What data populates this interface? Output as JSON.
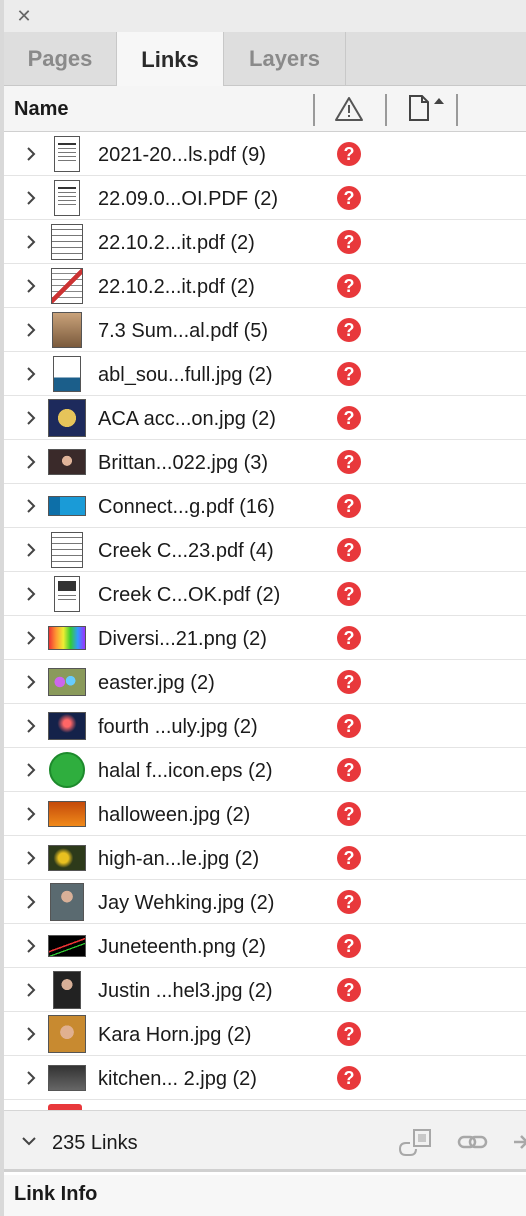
{
  "panel": {
    "close_glyph": "✕"
  },
  "tabs": [
    {
      "label": "Pages",
      "active": false
    },
    {
      "label": "Links",
      "active": true
    },
    {
      "label": "Layers",
      "active": false
    }
  ],
  "columns": {
    "name": "Name",
    "status_icon": "warning-triangle-icon",
    "page_icon": "page-sort-icon"
  },
  "links": [
    {
      "name": "2021-20...ls.pdf (9)",
      "thumb": "doc",
      "status": "missing"
    },
    {
      "name": "22.09.0...OI.PDF (2)",
      "thumb": "doc",
      "status": "missing"
    },
    {
      "name": "22.10.2...it.pdf (2)",
      "thumb": "table",
      "status": "missing"
    },
    {
      "name": "22.10.2...it.pdf (2)",
      "thumb": "table-red",
      "status": "missing"
    },
    {
      "name": "7.3 Sum...al.pdf (5)",
      "thumb": "photo-people",
      "status": "missing"
    },
    {
      "name": "abl_sou...full.jpg (2)",
      "thumb": "abl",
      "status": "missing"
    },
    {
      "name": "ACA acc...on.jpg (2)",
      "thumb": "badge",
      "status": "missing"
    },
    {
      "name": "Brittan...022.jpg (3)",
      "thumb": "portrait",
      "status": "missing"
    },
    {
      "name": "Connect...g.pdf (16)",
      "thumb": "blue-banner",
      "status": "missing"
    },
    {
      "name": "Creek C...23.pdf (4)",
      "thumb": "table",
      "status": "missing"
    },
    {
      "name": "Creek C...OK.pdf (2)",
      "thumb": "doc-dark",
      "status": "missing"
    },
    {
      "name": "Diversi...21.png (2)",
      "thumb": "diversity",
      "status": "missing"
    },
    {
      "name": "easter.jpg (2)",
      "thumb": "eggs",
      "status": "missing"
    },
    {
      "name": "fourth ...uly.jpg (2)",
      "thumb": "fireworks",
      "status": "missing"
    },
    {
      "name": "halal f...icon.eps (2)",
      "thumb": "halal",
      "status": "missing"
    },
    {
      "name": "halloween.jpg (2)",
      "thumb": "halloween",
      "status": "missing"
    },
    {
      "name": "high-an...le.jpg (2)",
      "thumb": "flowers",
      "status": "missing"
    },
    {
      "name": "Jay Wehking.jpg (2)",
      "thumb": "man-suit",
      "status": "missing"
    },
    {
      "name": "Juneteenth.png (2)",
      "thumb": "juneteenth",
      "status": "missing"
    },
    {
      "name": "Justin ...hel3.jpg (2)",
      "thumb": "man-dark",
      "status": "missing"
    },
    {
      "name": "Kara Horn.jpg (2)",
      "thumb": "woman",
      "status": "missing"
    },
    {
      "name": "kitchen... 2.jpg (2)",
      "thumb": "kitchen",
      "status": "missing"
    }
  ],
  "missing_glyph": "?",
  "footer": {
    "count_label": "235 Links",
    "icons": [
      "relink-to-folder-icon",
      "go-to-link-icon",
      "update-link-icon"
    ]
  },
  "link_info": {
    "title": "Link Info"
  },
  "colors": {
    "missing_red": "#e8383b",
    "panel_gray": "#dedede",
    "active_tab": "#f7f7f7"
  }
}
